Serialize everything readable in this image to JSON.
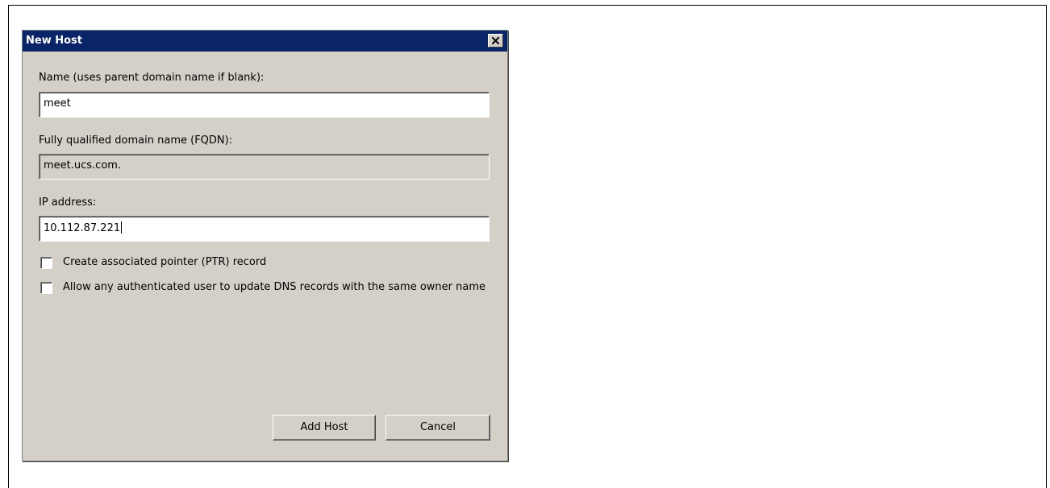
{
  "dialog": {
    "title": "New Host",
    "close_label": "×"
  },
  "form": {
    "name_label": "Name (uses parent domain name if blank):",
    "name_value": "meet",
    "fqdn_label": "Fully qualified domain name (FQDN):",
    "fqdn_value": "meet.ucs.com.",
    "ip_label": "IP address:",
    "ip_value": "10.112.87.221",
    "ptr_label": "Create associated pointer (PTR) record",
    "ptr_checked": false,
    "allow_label": "Allow any authenticated user to update DNS records with the same owner name",
    "allow_checked": false
  },
  "buttons": {
    "add_host": "Add Host",
    "cancel": "Cancel"
  },
  "colors": {
    "titlebar": "#0a246a",
    "dialog_face": "#d4d0c8",
    "field_bg": "#ffffff"
  },
  "icons": {
    "close": "close-icon"
  }
}
